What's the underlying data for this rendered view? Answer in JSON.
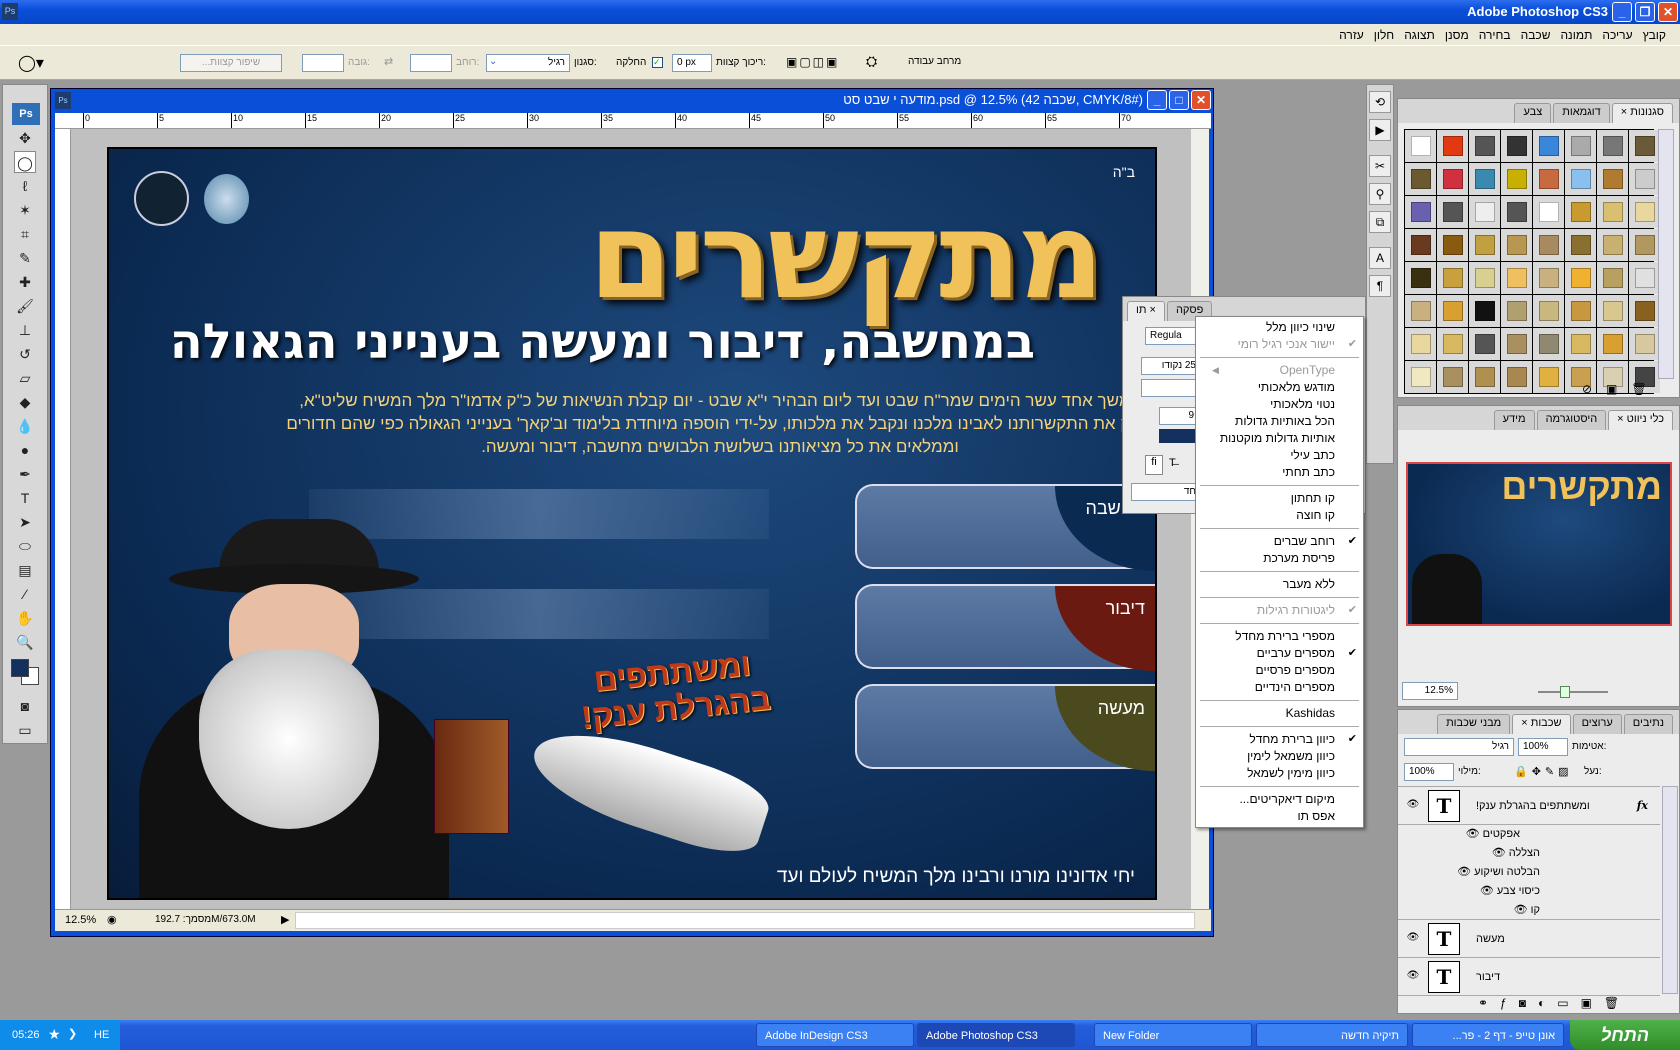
{
  "app": {
    "title": "Adobe Photoshop CS3",
    "ps_badge": "Ps"
  },
  "menu": [
    "קובץ",
    "עריכה",
    "תמונה",
    "שכבה",
    "בחירה",
    "מסנן",
    "תצוגה",
    "חלון",
    "עזרה"
  ],
  "options": {
    "workspace": "מרחב עבודה",
    "feather_label": "ריכוך קצוות:",
    "feather_value": "0 px",
    "antialias_label": "החלקה",
    "style_label": "סגנון:",
    "style_value": "רגיל",
    "width_label": "רוחב:",
    "height_label": "גובה:",
    "refine_label": "שיפור קצוות..."
  },
  "document": {
    "title": "מודעה י שבט סט.psd @ 12.5% (שכבה 42, CMYK/8#)",
    "zoom": "12.5%",
    "doc_size": "מסמך: 192.7M/673.0M",
    "ruler_ticks": [
      "0",
      "5",
      "10",
      "15",
      "20",
      "25",
      "30",
      "35",
      "40",
      "45",
      "50",
      "55",
      "60",
      "65",
      "70"
    ],
    "poster": {
      "bh": "ב\"ה",
      "title": "מתקשרים",
      "subtitle": "במחשבה, דיבור ומעשה בענייני הגאולה",
      "body": "במשך אחד עשר הימים שמר\"ח שבט ועד ליום הבהיר י\"א שבט - יום קבלת הנשיאות של כ\"ק אדמו\"ר מלך המשיח שליט\"א, נחזק את התקשרותנו לאבינו מלכנו ונקבל את מלכותו, על-ידי הוספה מיוחדת בלימוד וב'קאך' בענייני הגאולה כפי שהם חדורים וממלאים את כל מציאותנו בשלושת הלבושים מחשבה, דיבור ומעשה.",
      "boxes": [
        {
          "label": "מחשבה",
          "color": "#0b2a52"
        },
        {
          "label": "דיבור",
          "color": "#6b1a12"
        },
        {
          "label": "מעשה",
          "color": "#4a4a1e"
        }
      ],
      "lottery": [
        "ומשתתפים",
        "בהגרלת ענק!"
      ],
      "footer": "יחי אדונינו מורנו ורבינו מלך המשיח לעולם ועד"
    }
  },
  "character_panel": {
    "tabs": [
      "תו",
      "פסקה"
    ],
    "font_style": "Regula",
    "size": "25 נקודו",
    "tracking": "9",
    "language": "חד"
  },
  "context_menu": [
    {
      "label": "שינוי כיוון מלל"
    },
    {
      "label": "יישור אנכי רגיל רומי",
      "checked": true,
      "disabled": true
    },
    {
      "sep": true
    },
    {
      "label": "OpenType",
      "disabled": true,
      "submenu": true
    },
    {
      "label": "מודגש מלאכותי"
    },
    {
      "label": "נטוי מלאכותי"
    },
    {
      "label": "הכל באותיות גדולות"
    },
    {
      "label": "אותיות גדולות מוקטנות"
    },
    {
      "label": "כתב עילי"
    },
    {
      "label": "כתב תחתי"
    },
    {
      "sep": true
    },
    {
      "label": "קו תחתון"
    },
    {
      "label": "קו חוצה"
    },
    {
      "sep": true
    },
    {
      "label": "רוחב שברים",
      "checked": true
    },
    {
      "label": "פריסת מערכת"
    },
    {
      "sep": true
    },
    {
      "label": "ללא מעבר"
    },
    {
      "sep": true
    },
    {
      "label": "ליגטורות רגילות",
      "checked": true,
      "disabled": true
    },
    {
      "sep": true
    },
    {
      "label": "מספרי ברירת מחדל"
    },
    {
      "label": "מספרים ערביים",
      "checked": true
    },
    {
      "label": "מספרים פרסיים"
    },
    {
      "label": "מספרים הינדיים"
    },
    {
      "sep": true
    },
    {
      "label": "Kashidas"
    },
    {
      "sep": true
    },
    {
      "label": "כיוון ברירת מחדל",
      "checked": true
    },
    {
      "label": "כיוון משמאל לימין"
    },
    {
      "label": "כיוון מימין לשמאל"
    },
    {
      "sep": true
    },
    {
      "label": "מיקום דיאקריטים..."
    },
    {
      "label": "אפס תו"
    }
  ],
  "styles_panel": {
    "tabs": [
      "סגנונות",
      "דוגמאות",
      "צבע"
    ],
    "swatch_colors": [
      "#fff",
      "#e23a10",
      "#555",
      "#333",
      "#3a86d8",
      "#aaa",
      "#777",
      "#6b5a3a",
      "#6b5a30",
      "#d03040",
      "#3a8ab0",
      "#c8b000",
      "#c86a40",
      "#8ac0f0",
      "#b07a30",
      "#ccc",
      "#6a60b0",
      "#555",
      "#eee",
      "#555",
      "#fff",
      "#c89a30",
      "#d8c070",
      "#e8d8a0",
      "#6a3a20",
      "#8a5a10",
      "#c0a040",
      "#b89850",
      "#a88a60",
      "#8a7030",
      "#c8b070",
      "#b09860",
      "#3a3010",
      "#c8a040",
      "#d8d090",
      "#f0c060",
      "#c8b080",
      "#f0b030",
      "#b8a060",
      "#e0e0e0",
      "#c8b080",
      "#d8a030",
      "#111",
      "#b0a070",
      "#c8b880",
      "#c89840",
      "#d8c890",
      "#8a6020",
      "#e8d8a0",
      "#d8b860",
      "#555",
      "#a89060",
      "#908870",
      "#d8b860",
      "#d8a030",
      "#d8c8a0",
      "#f0e8c0",
      "#a89060",
      "#b09050",
      "#a88850",
      "#e0b040",
      "#c8a050",
      "#d8d0b0",
      "#444"
    ]
  },
  "navigator": {
    "tabs": [
      "כלי ניווט",
      "היסטוגרמה",
      "מידע"
    ],
    "zoom": "12.5%"
  },
  "layers": {
    "tabs": [
      "נתיבים",
      "ערוצים",
      "שכבות",
      "מבני שכבות"
    ],
    "blend_mode": "רגיל",
    "opacity_label": "אטימות:",
    "opacity": "100%",
    "lock_label": "נעל:",
    "fill_label": "מילוי:",
    "fill": "100%",
    "items": [
      {
        "name": "ומשתתפים  בהגרלת ענק!",
        "fx": "fx"
      },
      {
        "name": "מעשה"
      },
      {
        "name": "דיבור"
      }
    ],
    "effects_label": "אפקטים",
    "effects": [
      "הצללה",
      "הבלטה ושיקוע",
      "כיסוי צבע",
      "קו"
    ]
  },
  "taskbar": {
    "start": "התחל",
    "buttons": [
      "אונן טייפ - דף 2 - פר...",
      "תיקיה חדשה",
      "New Folder",
      "Adobe Photoshop CS3",
      "Adobe InDesign CS3"
    ],
    "lang": "HE",
    "clock": "05:26"
  }
}
